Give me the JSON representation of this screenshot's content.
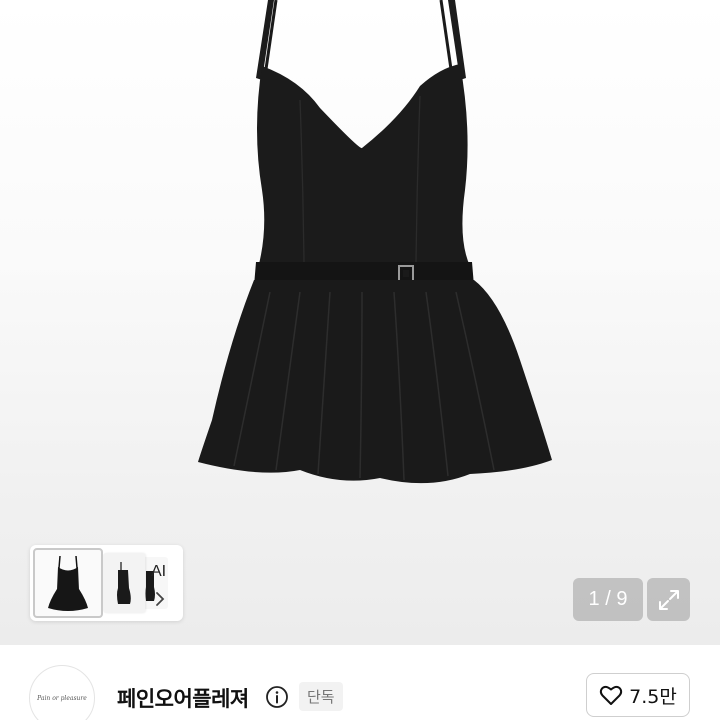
{
  "gallery": {
    "current_page": "1",
    "total_pages": "9",
    "page_indicator": "1 / 9",
    "background_color": "#f4f4f4",
    "product_color": "#161616"
  },
  "thumbnails": {
    "ai_label": "AI",
    "chevron_icon": "chevron-right-icon"
  },
  "expand": {
    "icon": "expand-arrows-icon"
  },
  "shop": {
    "logo_text": "Pain or pleasure",
    "name": "페인오어플레져",
    "info_icon": "info-icon",
    "badge": "단독"
  },
  "like": {
    "icon": "heart-icon",
    "count": "7.5만"
  }
}
